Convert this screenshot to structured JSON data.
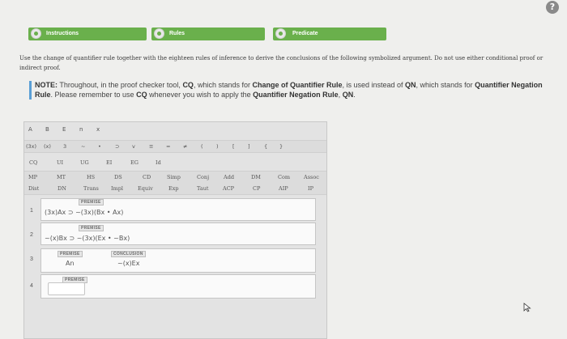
{
  "help_icon": "?",
  "tabs": [
    {
      "label": "Instructions"
    },
    {
      "label": "Rules"
    },
    {
      "label": "Predicate"
    }
  ],
  "instructions": "Use the change of quantifier rule together with the eighteen rules of inference to derive the conclusions of the following symbolized argument. Do not use either conditional proof or indirect proof.",
  "note": {
    "label": "NOTE:",
    "t1": " Throughout, in the proof checker tool, ",
    "b1": "CQ",
    "t2": ", which stands for ",
    "b2": "Change of Quantifier Rule",
    "t3": ", is used instead of ",
    "b3": "QN",
    "t4": ", which stands for ",
    "b4": "Quantifier Negation Rule",
    "t5": ". Please remember to use ",
    "b5": "CQ",
    "t6": " whenever you wish to apply the ",
    "b6": "Quantifier Negation Rule",
    "t7": ", ",
    "b7": "QN",
    "t8": "."
  },
  "toolbar": {
    "row1": [
      "A",
      "B",
      "E",
      "n",
      "x"
    ],
    "row2": [
      "(3x)",
      "(x)",
      "3",
      "~",
      "•",
      "⊃",
      "v",
      "≡",
      "=",
      "≠",
      "(",
      ")",
      "[",
      "]",
      "{",
      "}"
    ]
  },
  "rules": {
    "row1": [
      "CQ",
      "UI",
      "UG",
      "EI",
      "EG",
      "Id"
    ],
    "row2": [
      "MP",
      "MT",
      "HS",
      "DS",
      "CD",
      "Simp",
      "Conj",
      "Add",
      "DM",
      "Com",
      "Assoc"
    ],
    "row3": [
      "Dist",
      "DN",
      "Trans",
      "Impl",
      "Equiv",
      "Exp",
      "Taut",
      "ACP",
      "CP",
      "AIP",
      "IP"
    ]
  },
  "proof": [
    {
      "num": "1",
      "tag": "PREMISE",
      "formula": "(3x)Ax ⊃ ~(3x)(Bx • Ax)"
    },
    {
      "num": "2",
      "tag": "PREMISE",
      "formula": "~(x)Bx ⊃ ~(3x)(Ex • ~Bx)"
    },
    {
      "num": "3",
      "tag": "PREMISE",
      "formula": "An",
      "conclusion_tag": "CONCLUSION",
      "conclusion": "~(x)Ex"
    },
    {
      "num": "4",
      "tag": "PREMISE",
      "formula": ""
    }
  ]
}
